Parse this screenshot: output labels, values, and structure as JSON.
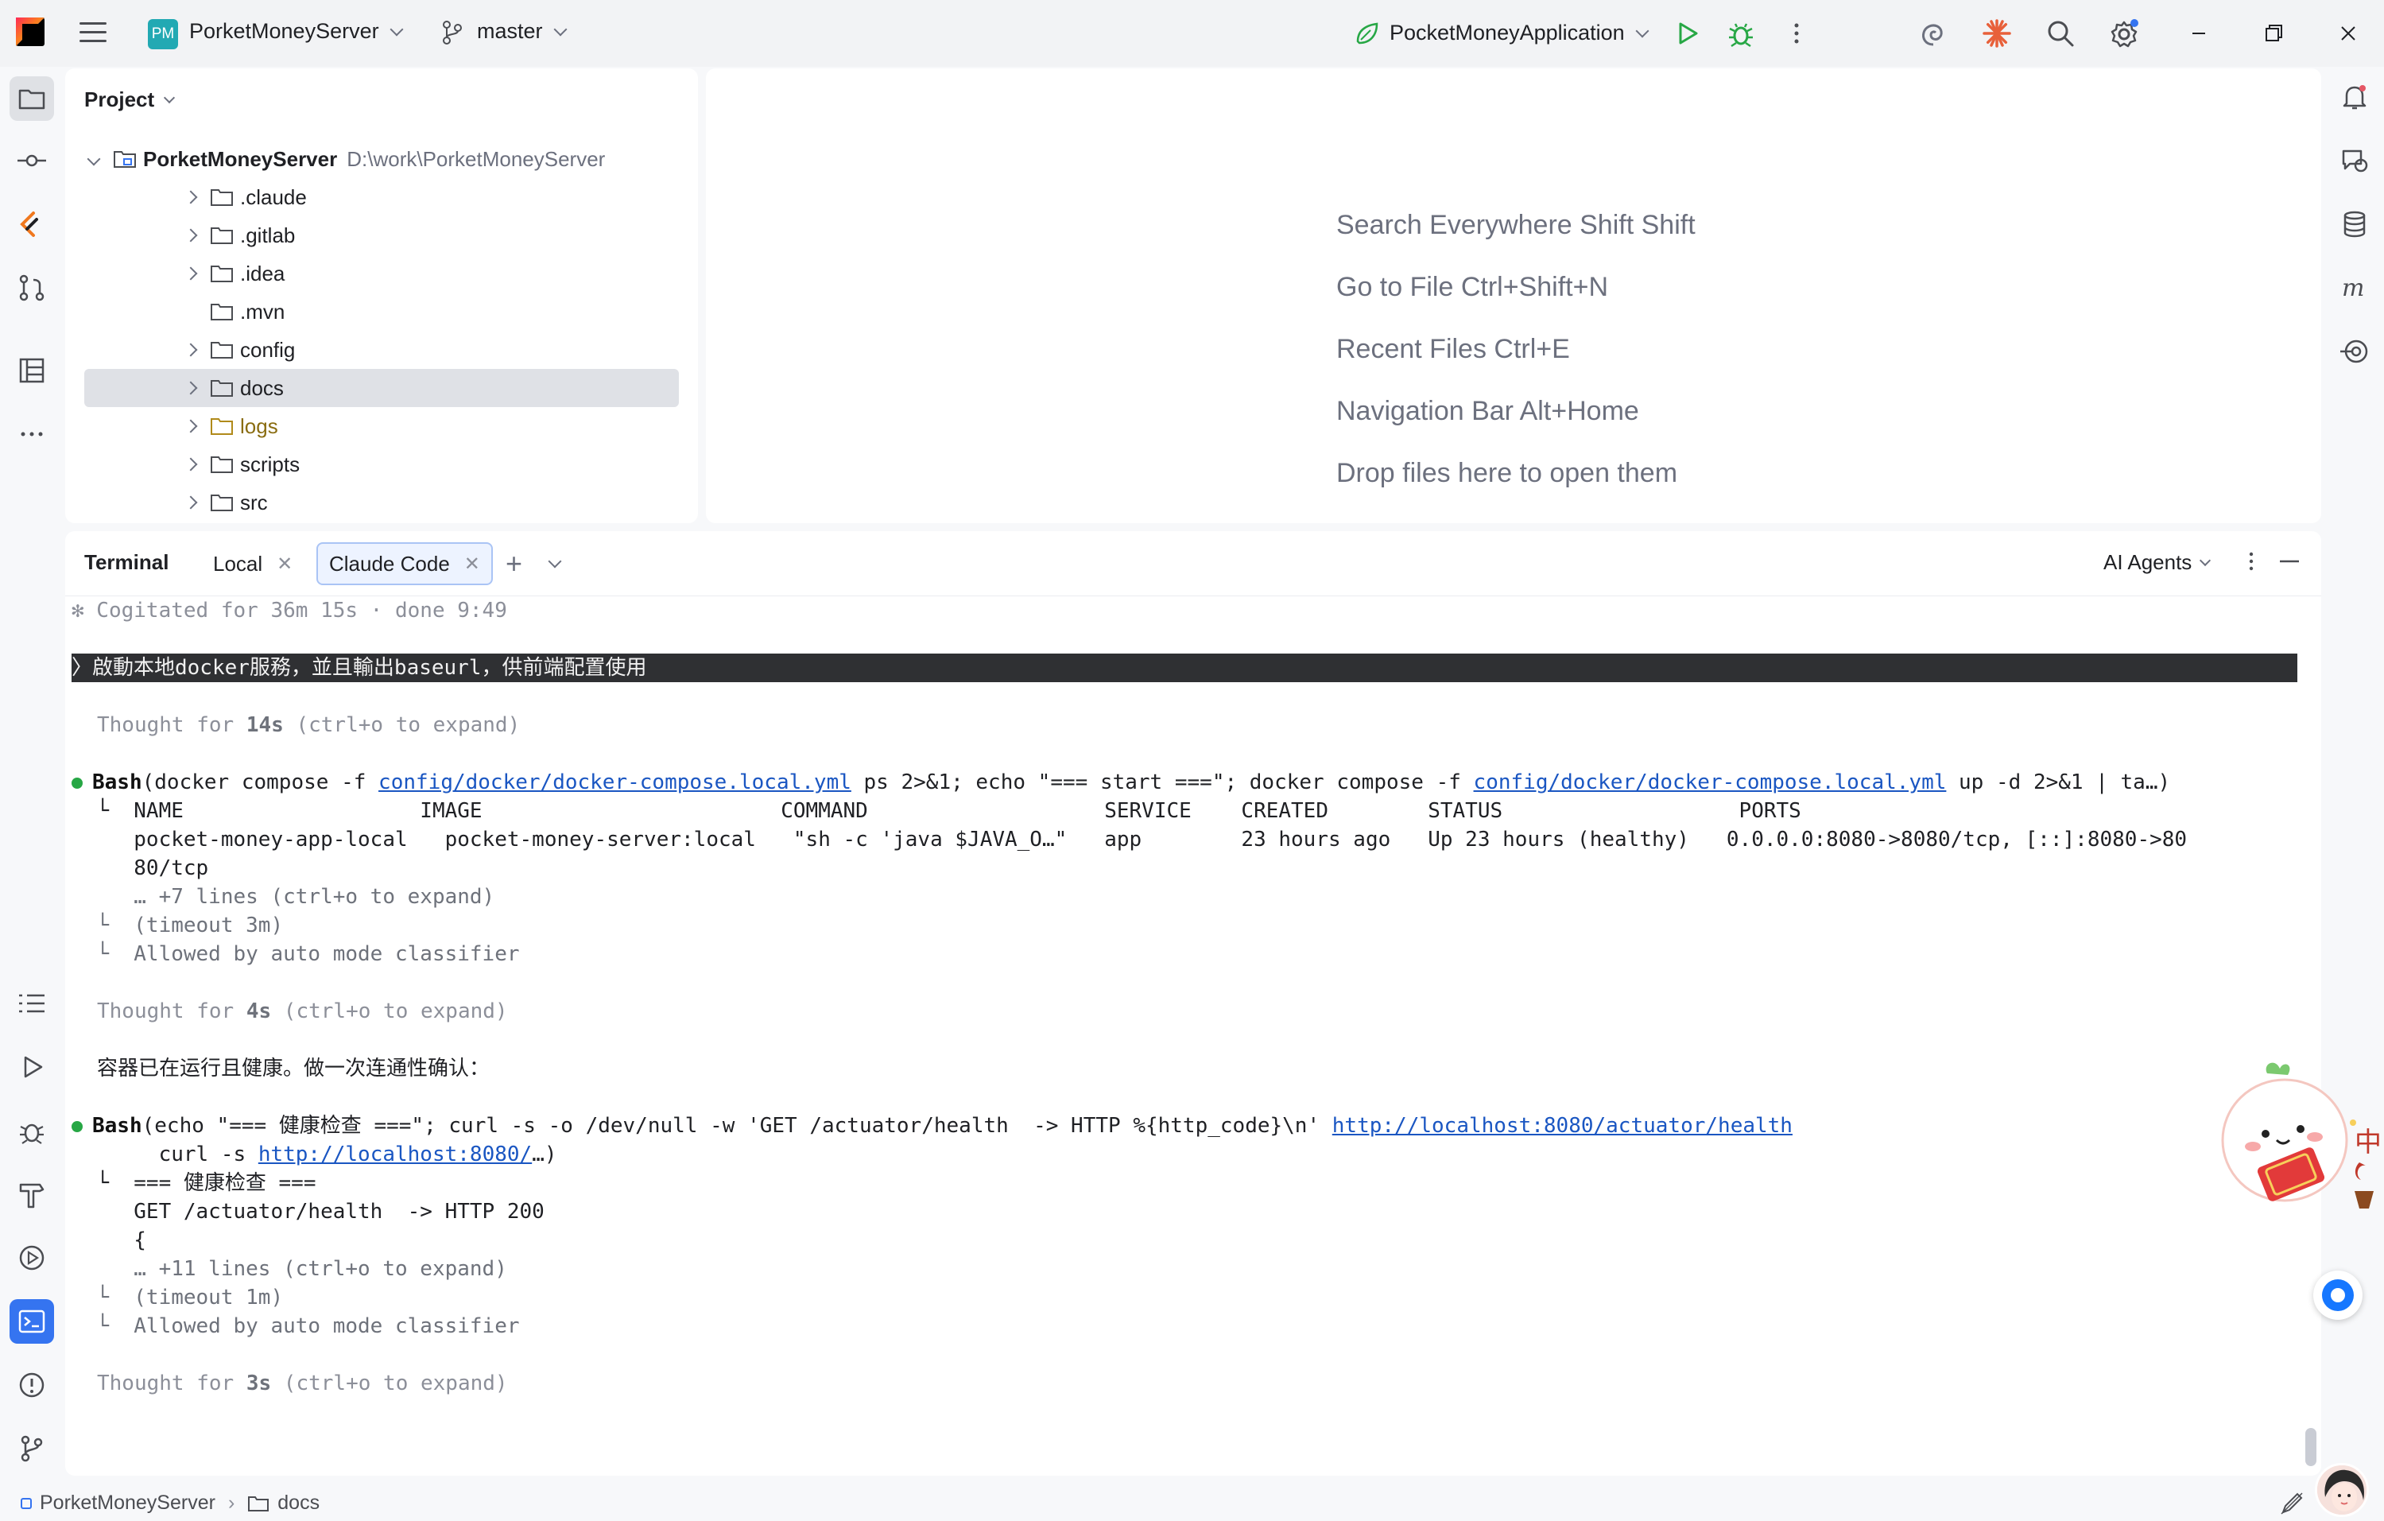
{
  "titlebar": {
    "project_badge": "PM",
    "project_name": "PorketMoneyServer",
    "branch": "master",
    "run_configuration": "PocketMoneyApplication"
  },
  "project_panel": {
    "header": "Project",
    "root": {
      "name": "PorketMoneyServer",
      "path": "D:\\work\\PorketMoneyServer"
    },
    "items": [
      {
        "label": ".claude",
        "expandable": true
      },
      {
        "label": ".gitlab",
        "expandable": true
      },
      {
        "label": ".idea",
        "expandable": true
      },
      {
        "label": ".mvn",
        "expandable": false
      },
      {
        "label": "config",
        "expandable": true
      },
      {
        "label": "docs",
        "expandable": true,
        "selected": true
      },
      {
        "label": "logs",
        "expandable": true
      },
      {
        "label": "scripts",
        "expandable": true
      },
      {
        "label": "src",
        "expandable": true
      }
    ]
  },
  "editor_hints": [
    "Search Everywhere Shift Shift",
    "Go to File Ctrl+Shift+N",
    "Recent Files Ctrl+E",
    "Navigation Bar Alt+Home",
    "Drop files here to open them"
  ],
  "terminal": {
    "title": "Terminal",
    "tabs": [
      {
        "label": "Local"
      },
      {
        "label": "Claude Code",
        "active": true
      }
    ],
    "agents_label": "AI Agents",
    "lines": {
      "cogitated": "✻ Cogitated for 36m 15s · done 9:49",
      "prompt": "〉啟動本地docker服務，並且輸出baseurl，供前端配置使用",
      "thought1_pre": "Thought for ",
      "thought1_time": "14s",
      "thought1_post": " (ctrl+o to expand)",
      "bash1_tool": "Bash",
      "bash1_a": "(docker compose -f ",
      "bash1_link1": "config/docker/docker-compose.local.yml",
      "bash1_b": " ps 2>&1; echo \"=== start ===\"; docker compose -f ",
      "bash1_link2": "config/docker/docker-compose.local.yml",
      "bash1_c": " up -d 2>&1 | ta…)",
      "out1_header": "  └  NAME                   IMAGE                        COMMAND                   SERVICE    CREATED        STATUS                   PORTS",
      "out1_row": "     pocket-money-app-local   pocket-money-server:local   \"sh -c 'java $JAVA_O…\"   app        23 hours ago   Up 23 hours (healthy)   0.0.0.0:8080->8080/tcp, [::]:8080->80",
      "out1_wrap": "     80/tcp",
      "out1_more": "     … +7 lines (ctrl+o to expand)",
      "out1_timeout": "  └  (timeout 3m)",
      "out1_allowed": "  └  Allowed by auto mode classifier",
      "thought2_pre": "Thought for ",
      "thought2_time": "4s",
      "thought2_post": " (ctrl+o to expand)",
      "msg": "容器已在运行且健康。做一次连通性确认：",
      "bash2_tool": "Bash",
      "bash2_a": "(echo \"=== 健康检查 ===\"; curl -s -o /dev/null -w 'GET /actuator/health  -> HTTP %{http_code}\\n' ",
      "bash2_link1": "http://localhost:8080/actuator/health",
      "bash2_cont_a": "       curl -s ",
      "bash2_link2": "http://localhost:8080/",
      "bash2_cont_b": "…)",
      "out2_1": "  └  === 健康检查 ===",
      "out2_2": "     GET /actuator/health  -> HTTP 200",
      "out2_3": "     {",
      "out2_more": "     … +11 lines (ctrl+o to expand)",
      "out2_timeout": "  └  (timeout 1m)",
      "out2_allowed": "  └  Allowed by auto mode classifier",
      "thought3_pre": "Thought for ",
      "thought3_time": "3s",
      "thought3_post": " (ctrl+o to expand)"
    }
  },
  "statusbar": {
    "project": "PorketMoneyServer",
    "folder": "docs"
  },
  "mascot_text": "中",
  "colors": {
    "accent": "#3574f0",
    "run_green": "#27a745",
    "link": "#1a56c2"
  }
}
